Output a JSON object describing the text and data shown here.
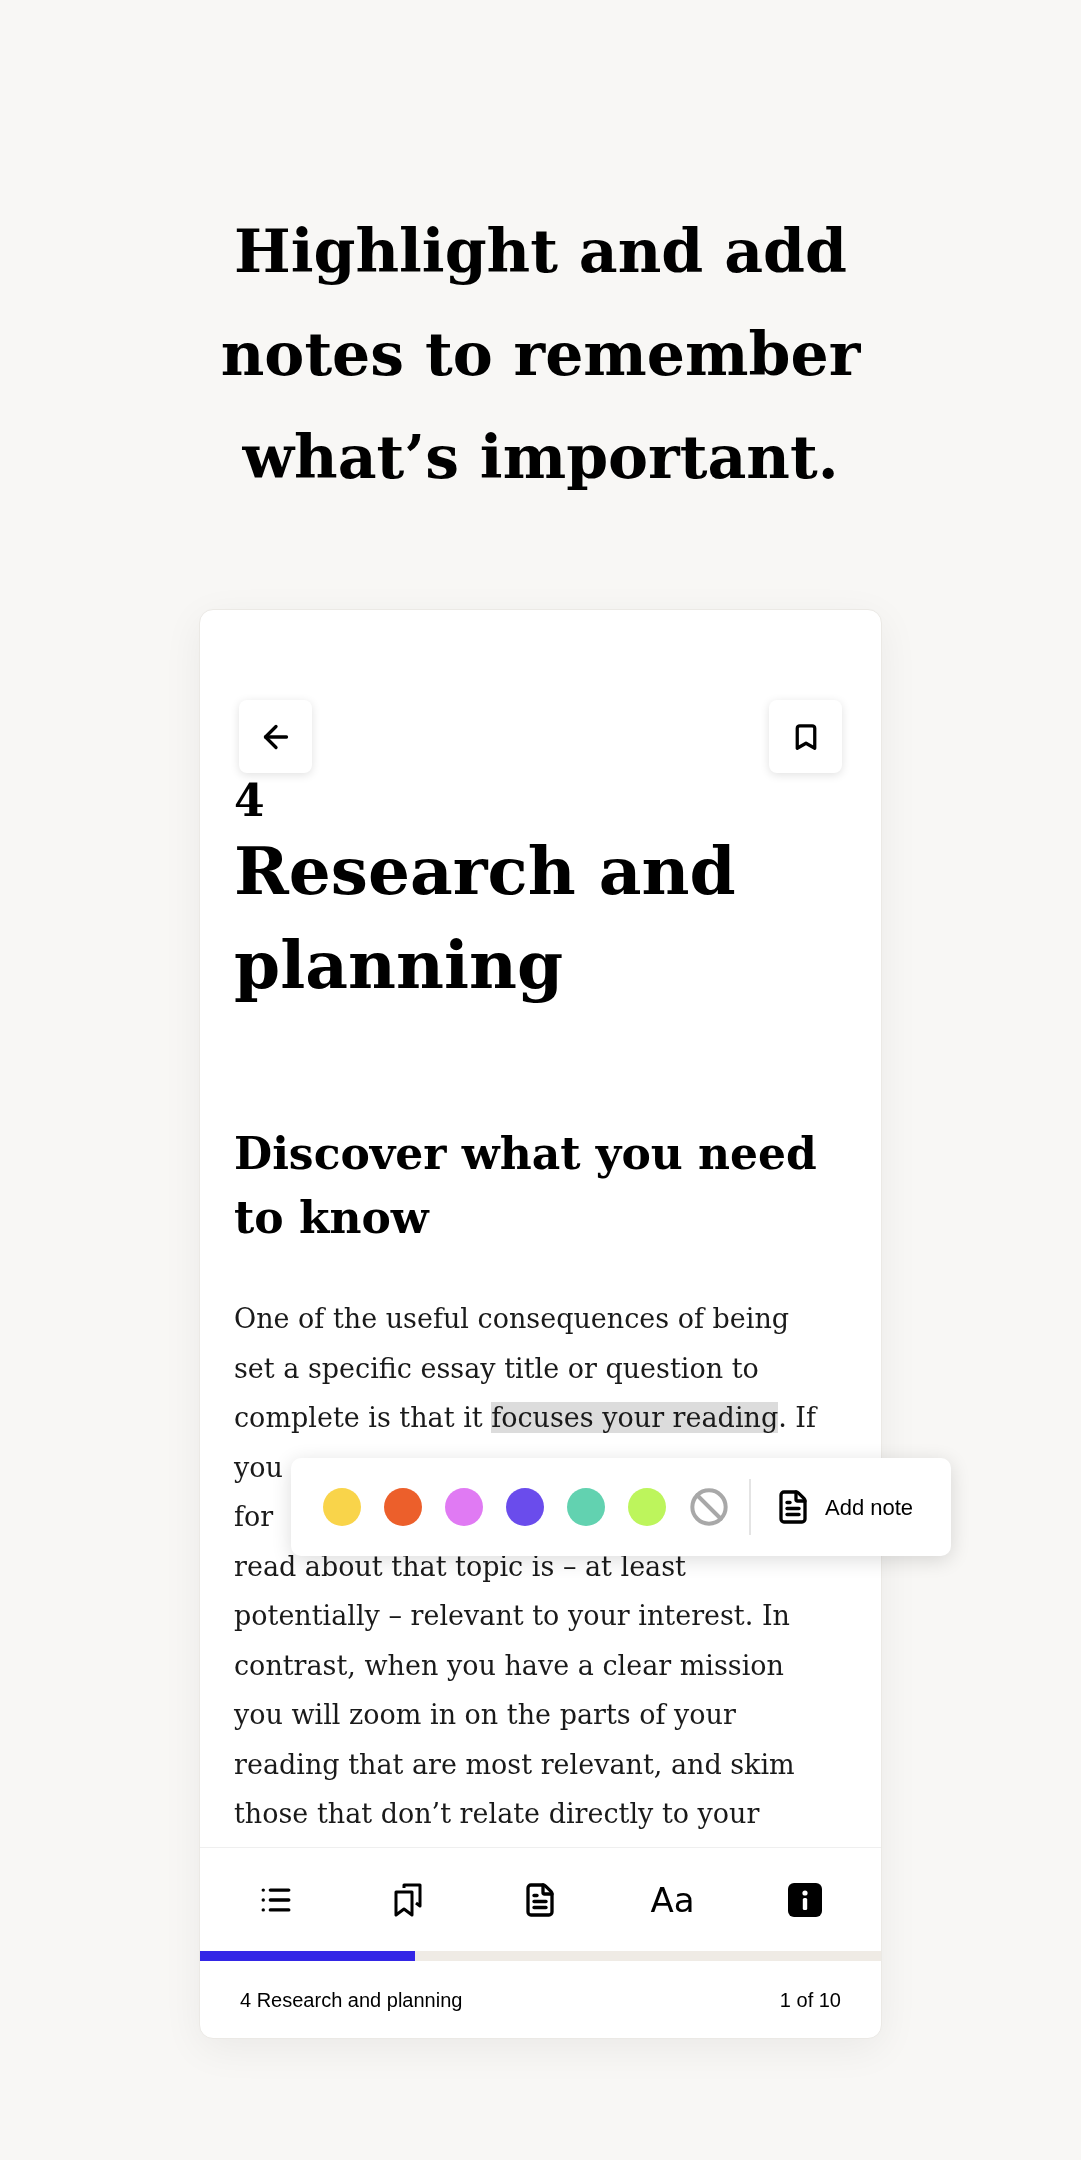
{
  "headline": [
    "Highlight and add",
    "notes to remember",
    "what’s important."
  ],
  "reader": {
    "chapter_number": "4",
    "chapter_title": "Research and planning",
    "section_heading": "Discover what you need to know",
    "body_lines": [
      {
        "segments": [
          {
            "text": "One of the useful consequences of being",
            "highlighted": false
          }
        ]
      },
      {
        "segments": [
          {
            "text": "set a specific essay title or question to",
            "highlighted": false
          }
        ]
      },
      {
        "segments": [
          {
            "text": "complete is that it ",
            "highlighted": false
          },
          {
            "text": "focuses your reading",
            "highlighted": true
          },
          {
            "text": ". If",
            "highlighted": false
          }
        ]
      },
      {
        "segments": [
          {
            "text": "you",
            "highlighted": false
          }
        ]
      },
      {
        "segments": [
          {
            "text": "for",
            "highlighted": false
          }
        ]
      },
      {
        "segments": [
          {
            "text": "read about that topic is – at least",
            "highlighted": false
          }
        ]
      },
      {
        "segments": [
          {
            "text": "potentially – relevant to your interest. In",
            "highlighted": false
          }
        ]
      },
      {
        "segments": [
          {
            "text": "contrast, when you have a clear mission",
            "highlighted": false
          }
        ]
      },
      {
        "segments": [
          {
            "text": "you will zoom in on the parts of your",
            "highlighted": false
          }
        ]
      },
      {
        "segments": [
          {
            "text": "reading that are most relevant, and skim",
            "highlighted": false
          }
        ]
      },
      {
        "segments": [
          {
            "text": "those that don’t relate directly to your",
            "highlighted": false
          }
        ]
      }
    ],
    "highlight_menu": {
      "swatches": [
        {
          "kind": "color",
          "color": "#f9d44a"
        },
        {
          "kind": "color",
          "color": "#ec5f2b"
        },
        {
          "kind": "color",
          "color": "#e07af3"
        },
        {
          "kind": "color",
          "color": "#6a4cec"
        },
        {
          "kind": "color",
          "color": "#62d2b0"
        },
        {
          "kind": "color",
          "color": "#bdf55c"
        },
        {
          "kind": "none"
        }
      ],
      "add_note": "Add note"
    },
    "toolbar": [
      {
        "kind": "contents"
      },
      {
        "kind": "bookmarks"
      },
      {
        "kind": "notes"
      },
      {
        "kind": "text",
        "label": "Aa"
      },
      {
        "kind": "info"
      }
    ],
    "progress": {
      "level": 0.316
    },
    "footer": {
      "location": "4 Research and planning",
      "page": "1 of 10"
    }
  }
}
